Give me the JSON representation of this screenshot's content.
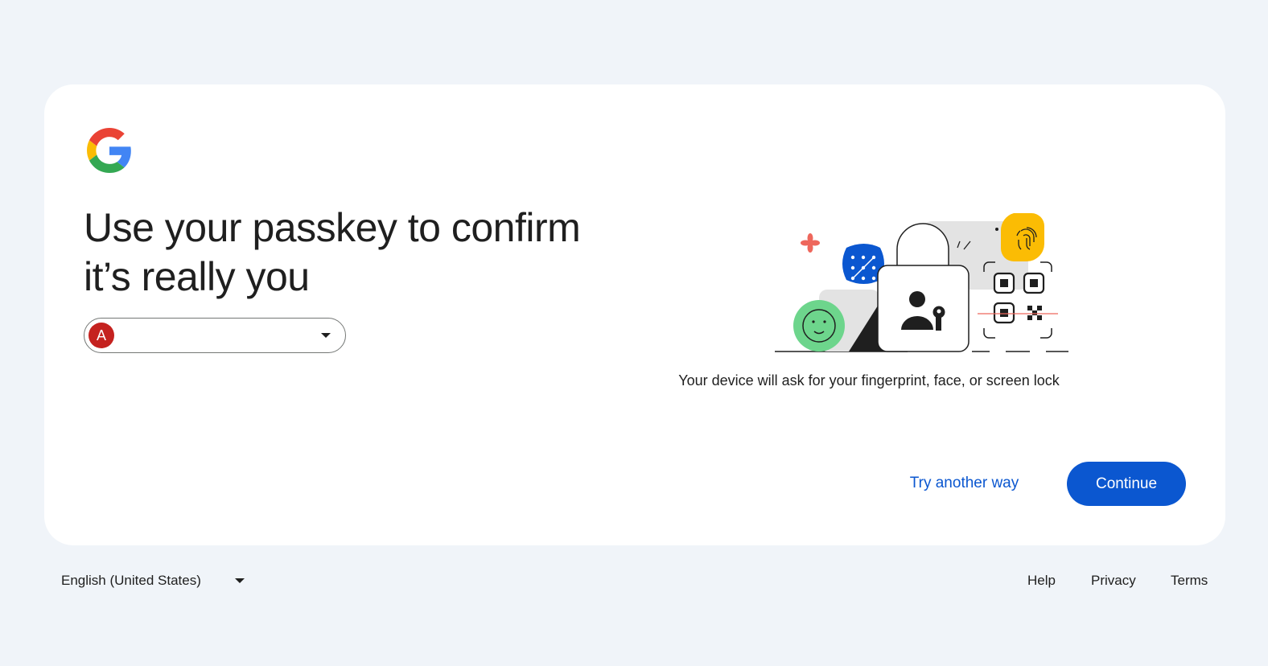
{
  "page": {
    "headline_line1": "Use your passkey to confirm",
    "headline_line2": "it’s really you",
    "account": {
      "avatar_letter": "A",
      "avatar_color": "#c5221f",
      "email": ""
    },
    "device_note": "Your device will ask for your fingerprint, face, or screen lock",
    "try_another_label": "Try another way",
    "continue_label": "Continue"
  },
  "footer": {
    "language": "English (United States)",
    "help": "Help",
    "privacy": "Privacy",
    "terms": "Terms"
  },
  "icons": {
    "logo": "google-g-logo",
    "chip_arrow": "dropdown-arrow-icon",
    "language_arrow": "dropdown-arrow-icon"
  },
  "colors": {
    "accent": "#0b57d0",
    "background": "#f0f4f9",
    "card": "#ffffff"
  }
}
